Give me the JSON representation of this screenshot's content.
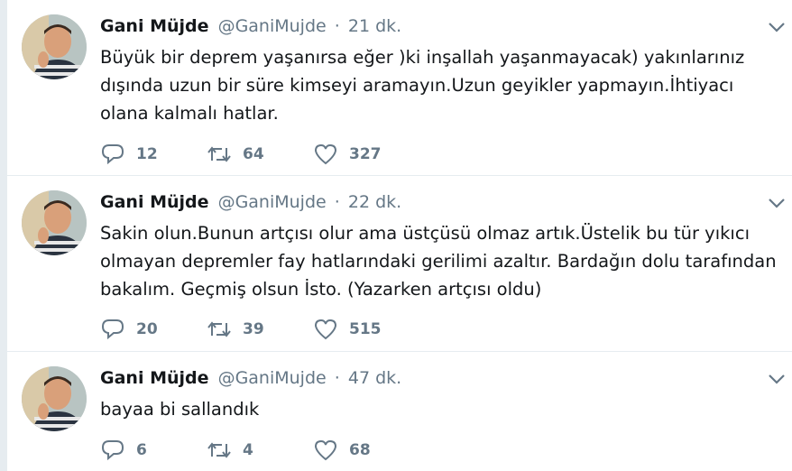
{
  "colors": {
    "name": "#14171a",
    "meta": "#657786",
    "divider": "#e6ecf0"
  },
  "icons": {
    "reply": "reply-icon",
    "retweet": "retweet-icon",
    "like": "heart-icon",
    "menu": "chevron-down-icon"
  },
  "tweets": [
    {
      "name": "Gani Müjde",
      "handle": "@GaniMujde",
      "sep": "·",
      "time": "21 dk.",
      "text": "Büyük bir deprem yaşanırsa eğer )ki inşallah yaşanmayacak) yakınlarınız dışında uzun bir süre kimseyi aramayın.Uzun geyikler yapmayın.İhtiyacı olana kalmalı hatlar.",
      "replies": "12",
      "retweets": "64",
      "likes": "327"
    },
    {
      "name": "Gani Müjde",
      "handle": "@GaniMujde",
      "sep": "·",
      "time": "22 dk.",
      "text": "Sakin olun.Bunun artçısı olur ama üstçüsü olmaz artık.Üstelik bu tür yıkıcı olmayan depremler fay hatlarındaki gerilimi azaltır. Bardağın dolu tarafından bakalım. Geçmiş olsun İsto.  (Yazarken artçısı oldu)",
      "replies": "20",
      "retweets": "39",
      "likes": "515"
    },
    {
      "name": "Gani Müjde",
      "handle": "@GaniMujde",
      "sep": "·",
      "time": "47 dk.",
      "text": "bayaa bi sallandık",
      "replies": "6",
      "retweets": "4",
      "likes": "68"
    }
  ]
}
